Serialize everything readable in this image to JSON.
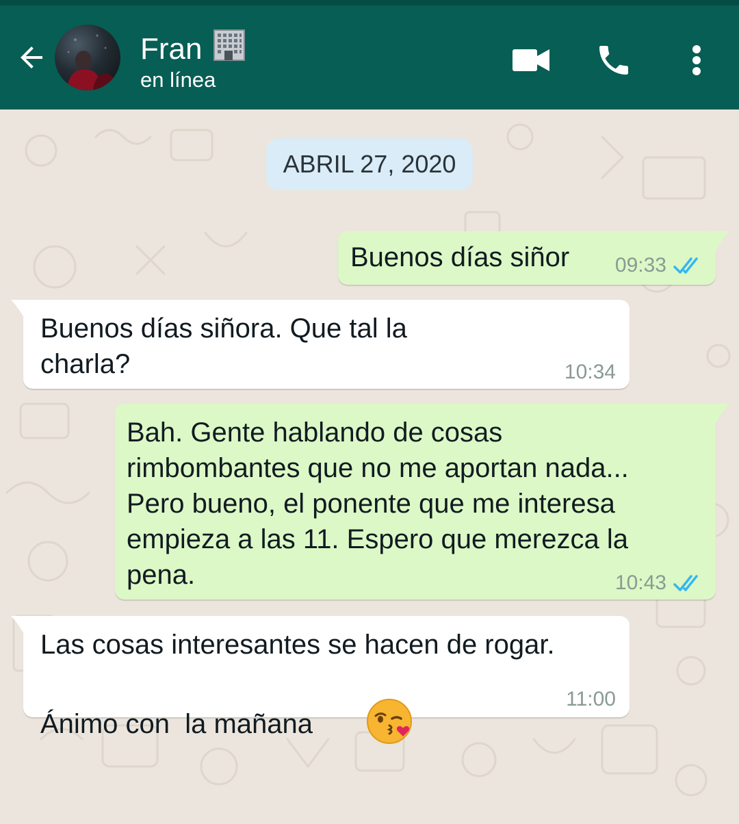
{
  "header": {
    "contact_name": "Fran",
    "contact_emoji": "🏢",
    "contact_status": "en línea"
  },
  "icons": {
    "back": "arrow-left-icon",
    "video": "video-camera-icon",
    "call": "phone-icon",
    "menu": "more-vert-icon"
  },
  "chat": {
    "date_label": "ABRIL 27, 2020",
    "messages": [
      {
        "direction": "out",
        "text": "Buenos días siñor",
        "time": "09:33",
        "status": "read"
      },
      {
        "direction": "in",
        "text": "Buenos días siñora. Que tal la\ncharla?",
        "time": "10:34"
      },
      {
        "direction": "out",
        "text": "Bah. Gente hablando de cosas\nrimbombantes que no me aportan nada...\nPero bueno, el ponente que me interesa\nempieza a las 11. Espero que merezca la\npena.",
        "time": "10:43",
        "status": "read"
      },
      {
        "direction": "in",
        "text": "Las cosas interesantes se hacen de rogar.\nÁnimo con  la mañana",
        "emoji": "😘",
        "time": "11:00"
      }
    ]
  },
  "colors": {
    "header": "#075e54",
    "outgoing_bubble": "#dcf8c6",
    "incoming_bubble": "#ffffff",
    "date_chip": "#d9ecf7",
    "read_ticks": "#34b7f1",
    "wallpaper": "#ece5dd"
  }
}
